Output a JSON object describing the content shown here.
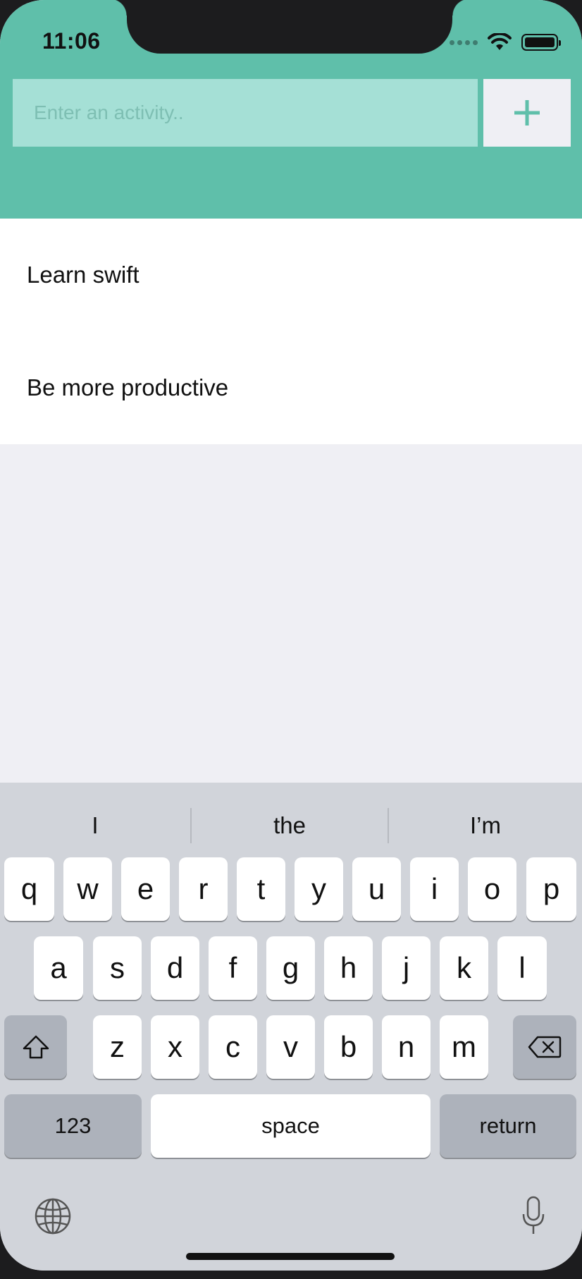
{
  "status_bar": {
    "time": "11:06"
  },
  "input": {
    "placeholder": "Enter an activity..",
    "value": ""
  },
  "add_button": {
    "icon": "plus-icon",
    "color": "#5fbfaa"
  },
  "activities": [
    "Learn swift",
    "Be more productive"
  ],
  "keyboard": {
    "suggestions": [
      "I",
      "the",
      "I’m"
    ],
    "row1": [
      "q",
      "w",
      "e",
      "r",
      "t",
      "y",
      "u",
      "i",
      "o",
      "p"
    ],
    "row2": [
      "a",
      "s",
      "d",
      "f",
      "g",
      "h",
      "j",
      "k",
      "l"
    ],
    "row3": [
      "z",
      "x",
      "c",
      "v",
      "b",
      "n",
      "m"
    ],
    "numbers_label": "123",
    "space_label": "space",
    "return_label": "return"
  },
  "colors": {
    "header": "#5fbfaa",
    "input_bg": "#a5e0d6",
    "keyboard_bg": "#d1d4da"
  }
}
